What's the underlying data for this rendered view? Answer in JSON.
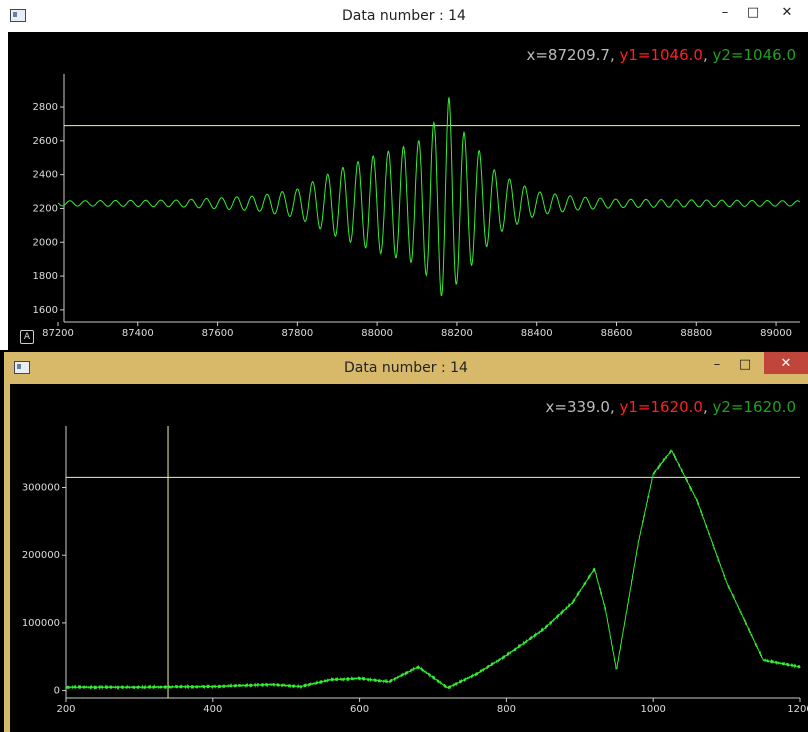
{
  "windows": [
    {
      "title": "Data number : 14",
      "controls": {
        "minimize": "–",
        "maximize": "□",
        "close": "✕"
      },
      "readout": {
        "x": "x=87209.7",
        "sep1": ", ",
        "y1": "y1=1046.0",
        "sep2": ", ",
        "y2": "y2=1046.0"
      },
      "auto_button": "A",
      "colors": {
        "x": "#bbbbbb",
        "y1": "#ff2020",
        "y2": "#20a020",
        "trace": "#33ee33",
        "cursor": "#f2f2a0"
      }
    },
    {
      "title": "Data number : 14",
      "controls": {
        "minimize": "–",
        "maximize": "□",
        "close": "✕"
      },
      "readout": {
        "x": "x=339.0",
        "sep1": ", ",
        "y1": "y1=1620.0",
        "sep2": ", ",
        "y2": "y2=1620.0"
      },
      "colors": {
        "x": "#bbbbbb",
        "y1": "#ff2020",
        "y2": "#20a020",
        "trace": "#33ee33",
        "cursor": "#f2f2a0"
      }
    }
  ],
  "chart_data": [
    {
      "type": "line",
      "title": "",
      "xlabel": "",
      "ylabel": "",
      "xlim": [
        87200,
        89060
      ],
      "ylim": [
        1540,
        2960
      ],
      "xticks": [
        87200,
        87400,
        87600,
        87800,
        88000,
        88200,
        88400,
        88600,
        88800,
        89000
      ],
      "yticks": [
        1600,
        1800,
        2000,
        2200,
        2400,
        2600,
        2800
      ],
      "cursor": {
        "hline_y": 2690
      },
      "series": [
        {
          "signal": "interferogram",
          "baseline": 2230,
          "center": 88180,
          "period": 38,
          "x": [
            87200,
            87500,
            87700,
            87800,
            87900,
            88000,
            88100,
            88150,
            88180,
            88200,
            88250,
            88300,
            88400,
            88500,
            88600,
            89060
          ],
          "envelope": [
            15,
            20,
            45,
            85,
            200,
            290,
            360,
            500,
            630,
            470,
            330,
            180,
            70,
            40,
            25,
            15
          ],
          "grid": false
        }
      ]
    },
    {
      "type": "line",
      "title": "",
      "xlabel": "",
      "ylabel": "",
      "xlim": [
        200,
        1200
      ],
      "ylim": [
        -8000,
        382000
      ],
      "xticks": [
        200,
        400,
        600,
        800,
        1000,
        1200
      ],
      "yticks": [
        0,
        100000,
        200000,
        300000
      ],
      "cursor": {
        "hline_y": 315000,
        "vline_x": 339
      },
      "series": [
        {
          "signal": "spectrum",
          "x": [
            200,
            300,
            400,
            480,
            520,
            560,
            600,
            640,
            680,
            720,
            760,
            800,
            850,
            890,
            920,
            935,
            950,
            980,
            1000,
            1025,
            1060,
            1100,
            1150,
            1200
          ],
          "y": [
            5000,
            5000,
            6000,
            9000,
            6000,
            16000,
            18000,
            13000,
            35000,
            4000,
            25000,
            52000,
            90000,
            130000,
            180000,
            120000,
            30000,
            220000,
            320000,
            355000,
            280000,
            160000,
            45000,
            35000
          ],
          "grid": false
        }
      ]
    }
  ]
}
